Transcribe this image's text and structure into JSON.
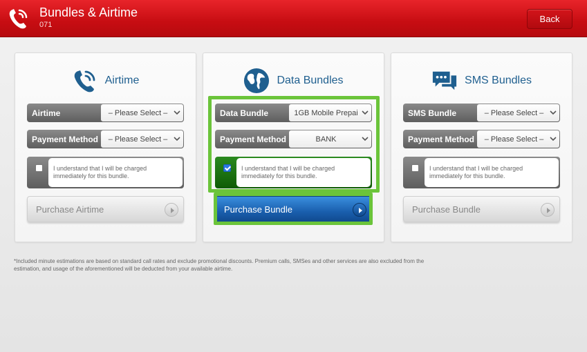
{
  "header": {
    "title": "Bundles & Airtime",
    "subtitle": "071",
    "back_label": "Back"
  },
  "colors": {
    "header_red": "#d3141a",
    "panel_title_blue": "#1f5f8f",
    "highlight_green": "#6bc43a",
    "purchase_active_blue": "#1a5fae",
    "checked_green": "#0f5b05"
  },
  "panels": [
    {
      "title": "Airtime",
      "icon": "phone-icon",
      "rows": [
        {
          "label": "Airtime",
          "value": "– Please Select –"
        },
        {
          "label": "Payment Method",
          "value": "– Please Select –"
        }
      ],
      "agree_text": "I understand that I will be charged immediately for this bundle.",
      "agree_checked": false,
      "purchase_label": "Purchase Airtime"
    },
    {
      "title": "Data Bundles",
      "icon": "globe-icon",
      "rows": [
        {
          "label": "Data Bundle",
          "value": "1GB Mobile Prepai"
        },
        {
          "label": "Payment Method",
          "value": "BANK"
        }
      ],
      "agree_text": "I understand that I will be charged immediately for this bundle.",
      "agree_checked": true,
      "purchase_label": "Purchase Bundle"
    },
    {
      "title": "SMS Bundles",
      "icon": "chat-bubbles-icon",
      "rows": [
        {
          "label": "SMS Bundle",
          "value": "– Please Select –"
        },
        {
          "label": "Payment Method",
          "value": "– Please Select –"
        }
      ],
      "agree_text": "I understand that I will be charged immediately for this bundle.",
      "agree_checked": false,
      "purchase_label": "Purchase Bundle"
    }
  ],
  "footnote": "*Included minute estimations are based on standard call rates and exclude promotional discounts. Premium calls, SMSes and other services are also excluded from the estimation, and usage of the aforementioned will be deducted from your available airtime."
}
